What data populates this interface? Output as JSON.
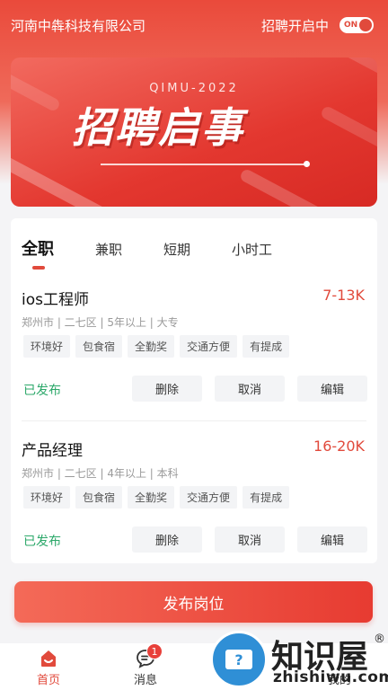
{
  "header": {
    "company": "河南中犇科技有限公司",
    "recruit_label": "招聘开启中",
    "switch_text": "ON"
  },
  "banner": {
    "subtitle": "QIMU-2022",
    "title": "招聘启事"
  },
  "tabs": [
    {
      "label": "全职",
      "active": true
    },
    {
      "label": "兼职"
    },
    {
      "label": "短期"
    },
    {
      "label": "小时工"
    }
  ],
  "jobs": [
    {
      "title": "ios工程师",
      "salary": "7-13K",
      "meta": "郑州市 | 二七区 | 5年以上 | 大专",
      "tags": [
        "环境好",
        "包食宿",
        "全勤奖",
        "交通方便",
        "有提成"
      ],
      "status": "已发布",
      "actions": [
        "删除",
        "取消",
        "编辑"
      ]
    },
    {
      "title": "产品经理",
      "salary": "16-20K",
      "meta": "郑州市 | 二七区 | 4年以上 | 本科",
      "tags": [
        "环境好",
        "包食宿",
        "全勤奖",
        "交通方便",
        "有提成"
      ],
      "status": "已发布",
      "actions": [
        "删除",
        "取消",
        "编辑"
      ]
    }
  ],
  "publish_button": "发布岗位",
  "tabbar": {
    "items": [
      {
        "label": "首页",
        "icon": "home-icon",
        "active": true
      },
      {
        "label": "消息",
        "icon": "message-icon",
        "badge": "1"
      },
      {
        "label": "",
        "icon": "resume-icon"
      },
      {
        "label": "我的",
        "icon": "user-icon"
      }
    ]
  },
  "watermark": {
    "logo": "知识屋",
    "reg": "®",
    "url": "zhishiwu.com",
    "glyph": "?"
  },
  "colors": {
    "accent": "#e14a3c",
    "published": "#2ca86a",
    "watermark_blue": "#2f8fd6"
  }
}
